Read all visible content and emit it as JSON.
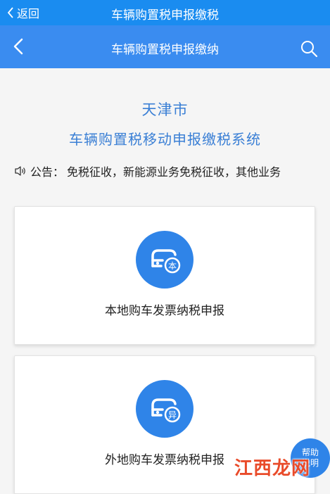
{
  "status_bar": {
    "back_label": "返回",
    "title": "车辆购置税申报缴税"
  },
  "nav_bar": {
    "title": "车辆购置税申报缴纳",
    "back_icon": "chevron-left-icon",
    "search_icon": "search-icon"
  },
  "header": {
    "city": "天津市",
    "system_name": "车辆购置税移动申报缴税系统"
  },
  "notice": {
    "icon": "speaker-icon",
    "label": "公告：",
    "text": "免税征收，新能源业务免税征收，其他业务"
  },
  "cards": [
    {
      "label": "本地购车发票纳税申报",
      "badge": "本",
      "icon": "car-local-icon"
    },
    {
      "label": "外地购车发票纳税申报",
      "badge": "异",
      "icon": "car-other-icon"
    }
  ],
  "help": {
    "line1": "帮助",
    "line2": "说明"
  },
  "watermark": {
    "text": "江西龙网"
  },
  "colors": {
    "status_bar": "#1a8cf0",
    "nav_bar": "#3a8cf0",
    "accent": "#2f84e8",
    "heading_text": "#3a7fd5",
    "background": "#f5f5f5"
  }
}
